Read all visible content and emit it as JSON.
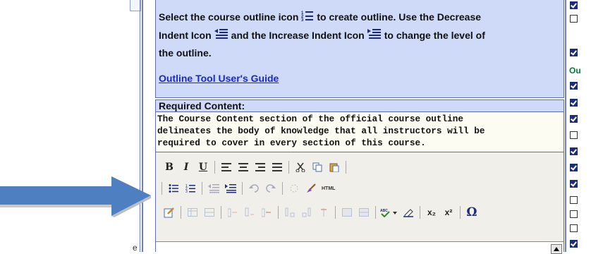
{
  "instructions": {
    "line1_pre": "Select the course outline icon",
    "line1_post": "to create outline. Use the Decrease",
    "line2_pre": "Indent Icon",
    "line2_mid": "and the Increase Indent Icon",
    "line2_post": "to change the level of",
    "line3": "the outline.",
    "link": "Outline Tool User's Guide"
  },
  "required": {
    "header": "Required Content:",
    "text_lines": [
      "The Course Content section of the official course outline",
      "delineates the body of knowledge that all instructors will be",
      "required to cover in every section of this course."
    ]
  },
  "toolbar": {
    "bold": "B",
    "italic": "I",
    "underline": "U",
    "html": "HTML",
    "subscript": "x₂",
    "superscript": "x²",
    "special_char": "Ω"
  },
  "left": {
    "letter": "e"
  },
  "right": {
    "label": "Ou"
  },
  "colors": {
    "panel_bg": "#cfdaf8",
    "border": "#5f6fae",
    "link": "#1a28c8",
    "arrow": "#4e7fc1"
  }
}
